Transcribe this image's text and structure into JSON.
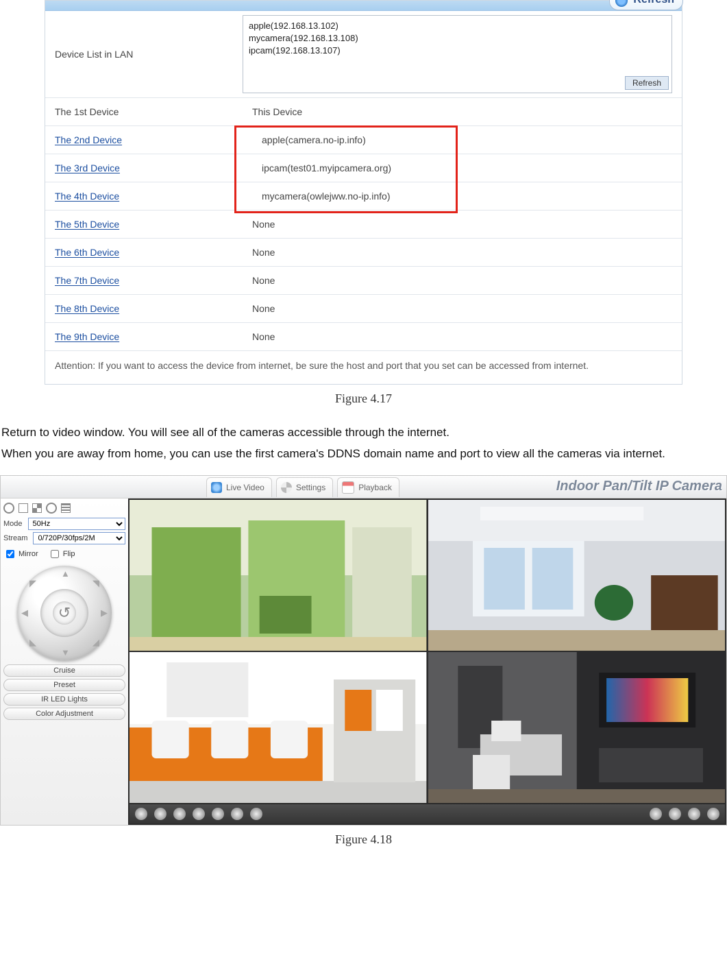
{
  "panel417": {
    "top_refresh": "Refresh",
    "device_list_label": "Device List in LAN",
    "device_list_items": [
      "apple(192.168.13.102)",
      "mycamera(192.168.13.108)",
      "ipcam(192.168.13.107)"
    ],
    "small_refresh": "Refresh",
    "rows": [
      {
        "label": "The 1st Device",
        "link": false,
        "value": "This Device",
        "hl": false
      },
      {
        "label": "The 2nd Device",
        "link": true,
        "value": "apple(camera.no-ip.info)",
        "hl": true
      },
      {
        "label": "The 3rd Device",
        "link": true,
        "value": "ipcam(test01.myipcamera.org)",
        "hl": true
      },
      {
        "label": "The 4th Device",
        "link": true,
        "value": "mycamera(owlejww.no-ip.info)",
        "hl": true
      },
      {
        "label": "The 5th Device",
        "link": true,
        "value": "None",
        "hl": false
      },
      {
        "label": "The 6th Device",
        "link": true,
        "value": "None",
        "hl": false
      },
      {
        "label": "The 7th Device",
        "link": true,
        "value": "None",
        "hl": false
      },
      {
        "label": "The 8th Device",
        "link": true,
        "value": "None",
        "hl": false
      },
      {
        "label": "The 9th Device",
        "link": true,
        "value": "None",
        "hl": false
      }
    ],
    "attention": "Attention: If you want to access the device from internet, be sure the host and port that you set can be accessed from internet."
  },
  "fig417": "Figure 4.17",
  "para1": "Return to video window. You will see all of the cameras accessible through the internet.",
  "para2": "When you are away from home, you can use the first camera's DDNS domain name and port to view all the cameras via internet.",
  "panel418": {
    "tabs": {
      "live": "Live Video",
      "settings": "Settings",
      "playback": "Playback"
    },
    "brand": "Indoor Pan/Tilt IP Camera",
    "side": {
      "mode_label": "Mode",
      "mode_value": "50Hz",
      "stream_label": "Stream",
      "stream_value": "0/720P/30fps/2M",
      "mirror": "Mirror",
      "flip": "Flip",
      "mirror_checked": true,
      "flip_checked": false,
      "buttons": [
        "Cruise",
        "Preset",
        "IR LED Lights",
        "Color Adjustment"
      ]
    }
  },
  "fig418": "Figure 4.18"
}
